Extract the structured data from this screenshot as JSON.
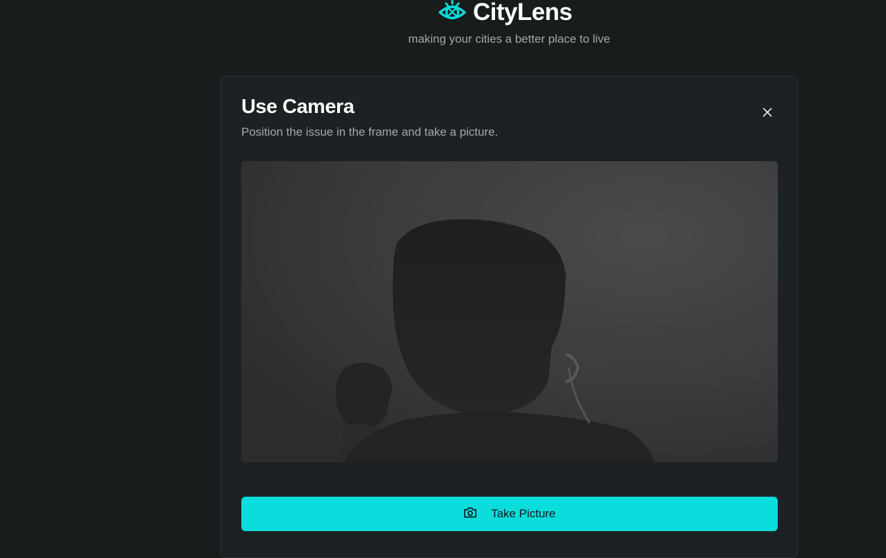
{
  "app": {
    "name": "CityLens",
    "tagline": "making your cities a better place to live",
    "logo_icon": "eye-target-icon",
    "accent_color": "#0bdcdc"
  },
  "dialog": {
    "title": "Use Camera",
    "description": "Position the issue in the frame and take a picture.",
    "close_icon": "close-icon",
    "camera_preview": "live-camera-feed",
    "take_picture_label": "Take Picture",
    "take_picture_icon": "camera-icon"
  }
}
